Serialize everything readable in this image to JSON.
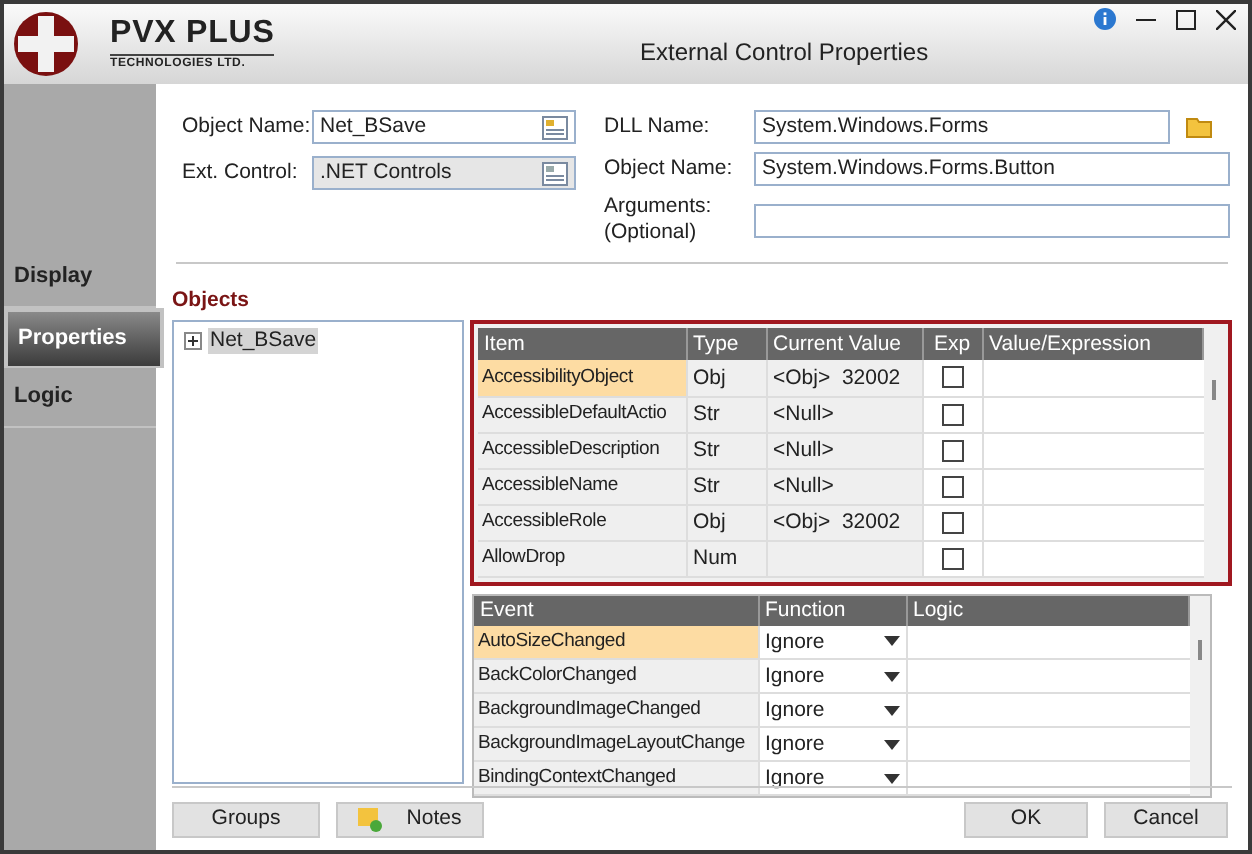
{
  "window": {
    "title": "External Control Properties",
    "logo": {
      "name": "PVX PLUS",
      "tagline": "TECHNOLOGIES LTD."
    }
  },
  "sidebar": {
    "items": [
      {
        "label": "Display",
        "selected": false
      },
      {
        "label": "Properties",
        "selected": true
      },
      {
        "label": "Logic",
        "selected": false
      }
    ]
  },
  "form": {
    "left": [
      {
        "label": "Object Name:",
        "value": "Net_BSave",
        "disabled": false
      },
      {
        "label": "Ext. Control:",
        "value": ".NET Controls",
        "disabled": true
      }
    ],
    "right": [
      {
        "label": [
          "DLL Name:"
        ],
        "value": "System.Windows.Forms",
        "browse": true
      },
      {
        "label": [
          "Object Name:"
        ],
        "value": "System.Windows.Forms.Button",
        "browse": false
      },
      {
        "label": [
          "Arguments:",
          "(Optional)"
        ],
        "browse": false
      }
    ]
  },
  "objects": {
    "title": "Objects",
    "tree": [
      {
        "label": "Net_BSave",
        "expanded": false,
        "selected": true
      }
    ]
  },
  "properties": {
    "columns": [
      "Item",
      "Type",
      "Current Value",
      "Exp",
      "Value/Expression"
    ],
    "rows": [
      {
        "item": "AccessibilityObject",
        "type": "Obj",
        "current_value": "<Obj>  32002",
        "exp": false,
        "selected": true
      },
      {
        "item": "AccessibleDefaultActio",
        "type": "Str",
        "current_value": "<Null>",
        "exp": false,
        "selected": false
      },
      {
        "item": "AccessibleDescription",
        "type": "Str",
        "current_value": "<Null>",
        "exp": false,
        "selected": false
      },
      {
        "item": "AccessibleName",
        "type": "Str",
        "current_value": "<Null>",
        "exp": false,
        "selected": false
      },
      {
        "item": "AccessibleRole",
        "type": "Obj",
        "current_value": "<Obj>  32002",
        "exp": false,
        "selected": false
      },
      {
        "item": "AllowDrop",
        "type": "Num",
        "exp": false,
        "selected": false
      }
    ]
  },
  "events": {
    "columns": [
      "Event",
      "Function",
      "Logic"
    ],
    "rows": [
      {
        "event": "AutoSizeChanged",
        "function": "Ignore",
        "selected": true
      },
      {
        "event": "BackColorChanged",
        "function": "Ignore",
        "selected": false
      },
      {
        "event": "BackgroundImageChanged",
        "function": "Ignore",
        "selected": false
      },
      {
        "event": "BackgroundImageLayoutChange",
        "function": "Ignore",
        "selected": false
      },
      {
        "event": "BindingContextChanged",
        "function": "Ignore",
        "selected": false
      }
    ]
  },
  "buttons": {
    "left": [
      {
        "label": "Groups",
        "kind": "plain"
      },
      {
        "label": "Notes",
        "kind": "note"
      }
    ],
    "right": [
      {
        "label": "OK",
        "kind": "plain"
      },
      {
        "label": "Cancel",
        "kind": "plain"
      }
    ]
  }
}
